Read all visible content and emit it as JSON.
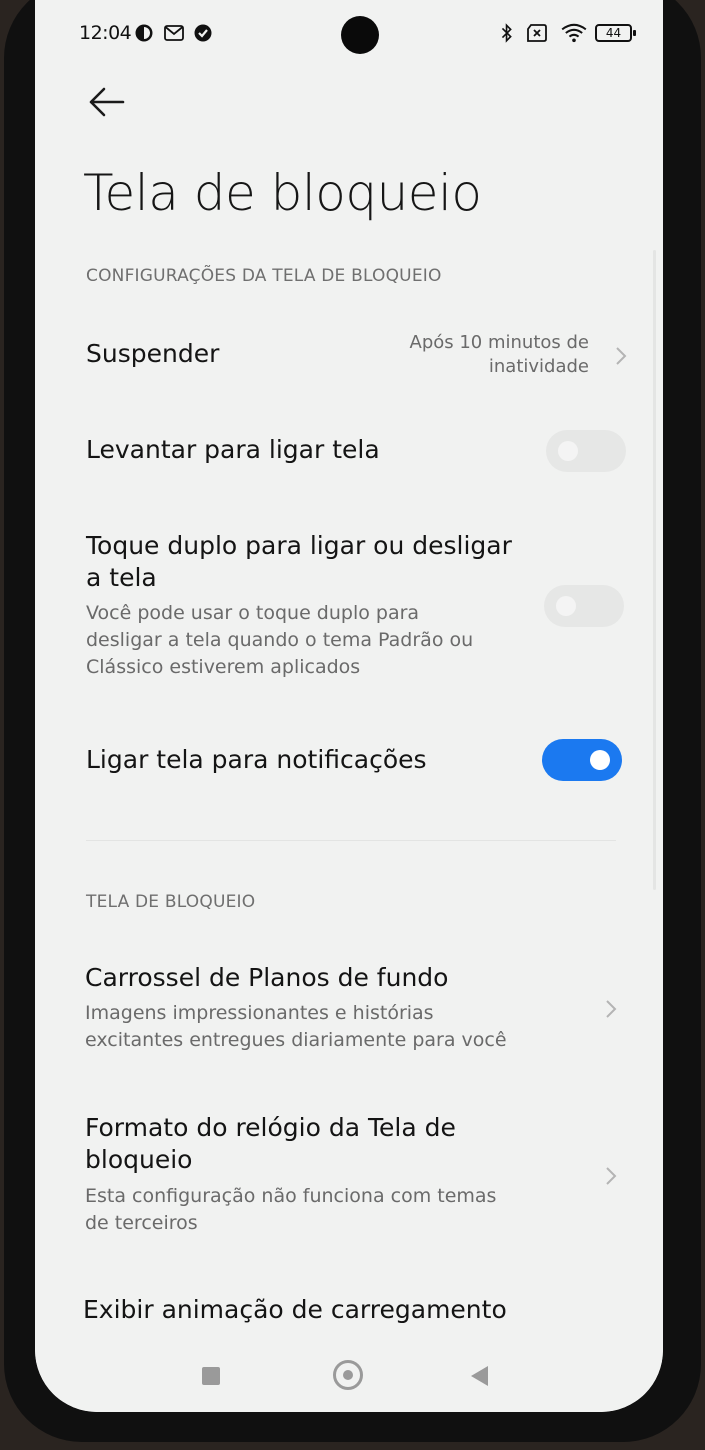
{
  "status_bar": {
    "time": "12:04",
    "battery": "44",
    "icons": [
      "data-saver-icon",
      "gmail-icon",
      "check-circle-icon",
      "bluetooth-icon",
      "no-sim-icon",
      "wifi-icon",
      "battery-icon"
    ]
  },
  "header": {
    "title": "Tela de bloqueio"
  },
  "sections": {
    "lock_settings": {
      "header": "CONFIGURAÇÕES DA TELA DE BLOQUEIO",
      "items": [
        {
          "title": "Suspender",
          "value_line1": "Após 10 minutos de",
          "value_line2": "inatividade"
        },
        {
          "title": "Levantar para ligar tela",
          "enabled": false
        },
        {
          "title_line1": "Toque duplo para ligar ou desligar",
          "title_line2": "a tela",
          "sub_line1": "Você pode usar o toque duplo para",
          "sub_line2": "desligar a tela quando o tema Padrão ou",
          "sub_line3": "Clássico estiverem aplicados",
          "enabled": false
        },
        {
          "title": "Ligar tela para notificações",
          "enabled": true
        }
      ]
    },
    "lock_screen": {
      "header": "TELA DE BLOQUEIO",
      "items": [
        {
          "title": "Carrossel de Planos de fundo",
          "sub_line1": "Imagens impressionantes e histórias",
          "sub_line2": "excitantes entregues diariamente para você"
        },
        {
          "title_line1": "Formato do relógio da Tela de",
          "title_line2": "bloqueio",
          "sub_line1": "Esta configuração não funciona com temas",
          "sub_line2": "de terceiros"
        },
        {
          "title": "Exibir animação de carregamento"
        }
      ]
    }
  },
  "colors": {
    "accent": "#1b79f0",
    "background": "#f1f2f1"
  }
}
